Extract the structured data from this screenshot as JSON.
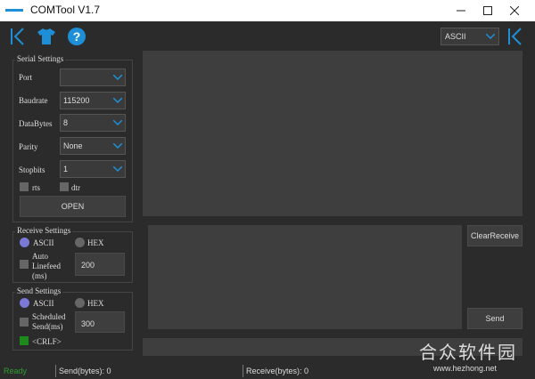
{
  "window": {
    "title": "COMTool V1.7"
  },
  "toolbar": {
    "encoding_value": "ASCII"
  },
  "serial": {
    "group_title": "Serial Settings",
    "port_label": "Port",
    "port_value": "",
    "baud_label": "Baudrate",
    "baud_value": "115200",
    "databytes_label": "DataBytes",
    "databytes_value": "8",
    "parity_label": "Parity",
    "parity_value": "None",
    "stopbits_label": "Stopbits",
    "stopbits_value": "1",
    "rts_label": "rts",
    "dtr_label": "dtr",
    "open_label": "OPEN"
  },
  "receive": {
    "group_title": "Receive Settings",
    "ascii_label": "ASCII",
    "hex_label": "HEX",
    "auto_linefeed_label1": "Auto",
    "auto_linefeed_label2": "Linefeed",
    "auto_linefeed_label3": "(ms)",
    "linefeed_value": "200",
    "clear_label": "ClearReceive"
  },
  "send": {
    "group_title": "Send Settings",
    "ascii_label": "ASCII",
    "hex_label": "HEX",
    "scheduled_label1": "Scheduled",
    "scheduled_label2": "Send(ms)",
    "scheduled_value": "300",
    "crlf_label": "<CRLF>",
    "send_label": "Send"
  },
  "status": {
    "state": "Ready",
    "sent": "Send(bytes): 0",
    "received": "Receive(bytes): 0"
  },
  "watermark": {
    "cn": "合众软件园",
    "url": "www.hezhong.net"
  },
  "colors": {
    "accent": "#1e8fd6",
    "radio_selected": "#7a7ad6",
    "ready": "#2e9e2e",
    "crlf_check": "#1d8a1d"
  }
}
